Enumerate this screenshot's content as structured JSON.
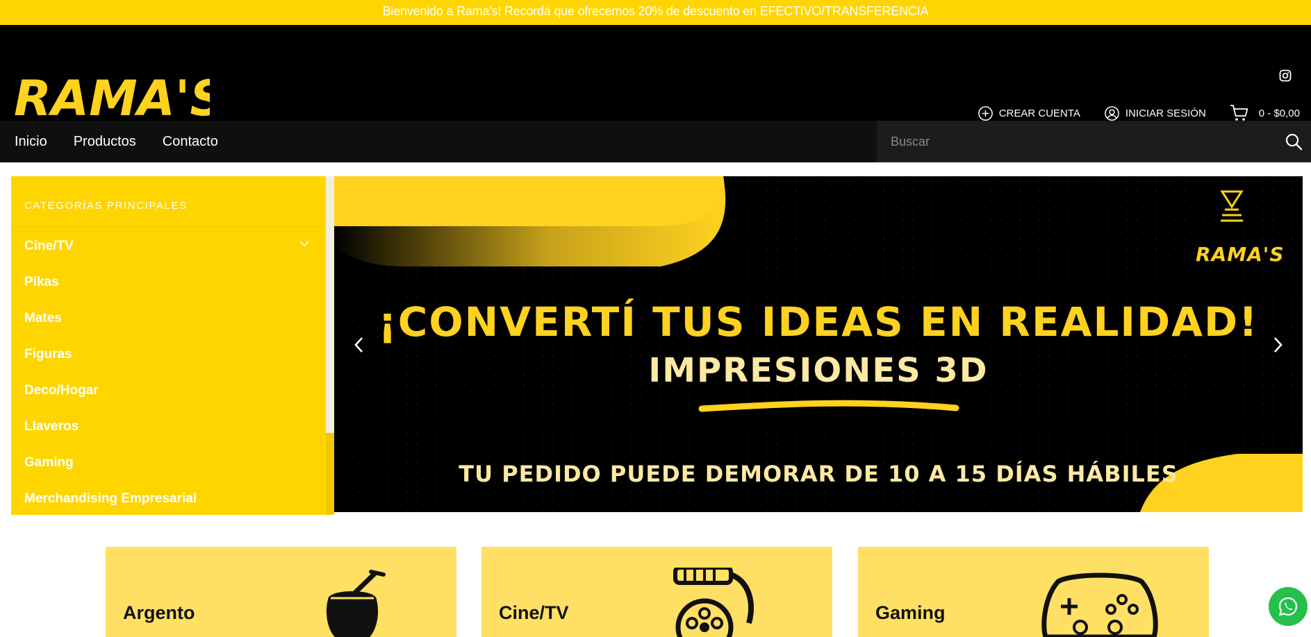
{
  "announcement": "Bienvenido a Rama's! Recordá que ofrecemos 20% de descuento en EFECTIVO/TRANSFERENCIA",
  "brand": {
    "logo_text": "RAMA'S"
  },
  "account": {
    "create": "CREAR CUENTA",
    "login": "INICIAR SESIÓN",
    "cart": "0 - $0,00"
  },
  "nav": {
    "items": [
      "Inicio",
      "Productos",
      "Contacto"
    ]
  },
  "search": {
    "placeholder": "Buscar"
  },
  "sidebar": {
    "title": "CATEGORÍAS PRINCIPALES",
    "categories": [
      "Cine/TV",
      "Pikas",
      "Mates",
      "Figuras",
      "Deco/Hogar",
      "Llaveros",
      "Gaming",
      "Merchandising Empresarial"
    ]
  },
  "banner": {
    "headline": "¡CONVERTÍ TUS IDEAS EN REALIDAD!",
    "subheadline": "IMPRESIONES 3D",
    "note": "TU PEDIDO PUEDE DEMORAR DE 10 A 15 DÍAS HÁBILES",
    "brand": "RAMA'S"
  },
  "category_cards": [
    {
      "label": "Argento",
      "icon": "mate-icon"
    },
    {
      "label": "Cine/TV",
      "icon": "film-reel-icon"
    },
    {
      "label": "Gaming",
      "icon": "gamepad-icon"
    }
  ],
  "colors": {
    "brand_yellow": "#ffd500",
    "card_yellow": "#ffe064",
    "header_black": "#000000",
    "whatsapp_green": "#25c04b"
  }
}
